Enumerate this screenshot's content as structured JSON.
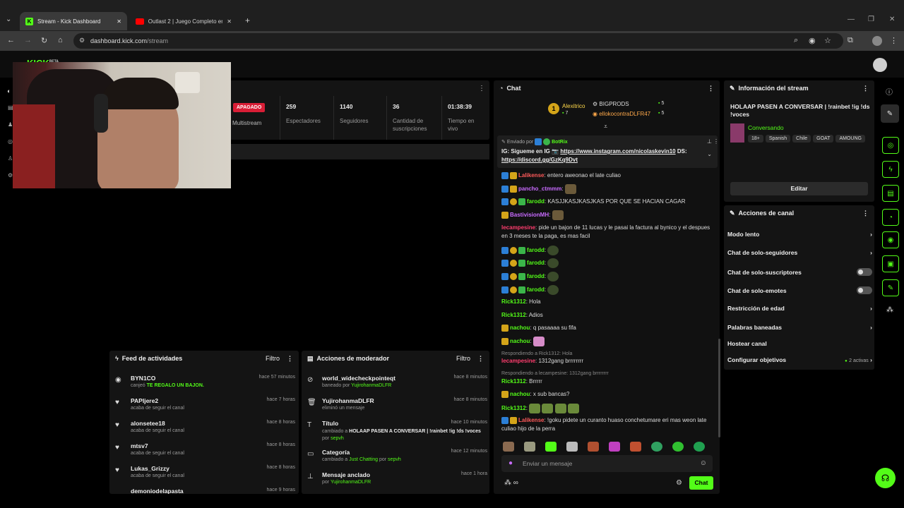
{
  "browser": {
    "tabs": [
      {
        "title": "Stream - Kick Dashboard"
      },
      {
        "title": "Outlast 2 | Juego Completo en"
      }
    ],
    "url": "dashboard.kick.com/stream",
    "url_host": "dashboard.kick.com",
    "url_path": "/stream"
  },
  "stats": {
    "status": "APAGADO",
    "multistream": "Multistream",
    "viewers_value": "259",
    "viewers_label": "Espectadores",
    "followers_value": "1140",
    "followers_label": "Seguidores",
    "subs_value": "36",
    "subs_label": "Cantidad de suscripciones",
    "live_value": "01:38:39",
    "live_label": "Tiempo en vivo"
  },
  "activity_feed": {
    "title": "Feed de actividades",
    "filter": "Filtro",
    "items": [
      {
        "user": "BYN1CO",
        "action": "canjeó",
        "extra": "TE REGALO UN BAJON.",
        "time": "hace 57 minutos"
      },
      {
        "user": "PAPIjere2",
        "action": "acaba de seguir el canal",
        "time": "hace 7 horas"
      },
      {
        "user": "alonsetee18",
        "action": "acaba de seguir el canal",
        "time": "hace 8 horas"
      },
      {
        "user": "mtsv7",
        "action": "acaba de seguir el canal",
        "time": "hace 8 horas"
      },
      {
        "user": "Lukas_Grizzy",
        "action": "acaba de seguir el canal",
        "time": "hace 8 horas"
      },
      {
        "user": "demoniodelapasta",
        "action": "",
        "time": "hace 9 horas"
      }
    ]
  },
  "mod_actions": {
    "title": "Acciones de moderador",
    "filter": "Filtro",
    "items": [
      {
        "title": "world_widecheckpointeqt",
        "sub1": "baneado por",
        "by": "YujirohanmaDLFR",
        "time": "hace 8 minutos"
      },
      {
        "title": "YujirohanmaDLFR",
        "sub1": "eliminó un mensaje",
        "by": "",
        "time": "hace 8 minutos"
      },
      {
        "title": "Título",
        "sub1": "cambiado a",
        "value": "HOLAAP PASEN A CONVERSAR | !rainbet !ig !ds !voces",
        "sub2": "por",
        "by": "sepvh",
        "time": "hace 10 minutos"
      },
      {
        "title": "Categoría",
        "sub1": "cambiado a",
        "value": "Just Chatting",
        "sub2": "por",
        "by": "sepvh",
        "time": "hace 12 minutos"
      },
      {
        "title": "Mensaje anclado",
        "sub1": "por",
        "by": "YujirohanmaDLFR",
        "time": "hace 1 hora"
      }
    ]
  },
  "chat": {
    "title": "Chat",
    "top_gifters": [
      {
        "name": "Alexitrico",
        "count": "7"
      },
      {
        "name": "BIGPRODS",
        "count": "5"
      },
      {
        "name": "ellokocontraDLFR47",
        "count": "5"
      }
    ],
    "pinned": {
      "sent_by": "Enviado por",
      "bot": "BotRix",
      "text": "IG: Sigueme en IG 📷 ",
      "link": "https://www.instagram.com/nicolaskevin10",
      "ds": " DS: ",
      "link2": "https://discord.gg/GzKq9Dvt"
    },
    "messages": [
      {
        "user": "Lalikense",
        "color": "#ff5a5a",
        "text": "entero aweonao el late culiao"
      },
      {
        "user": "pancho_ctmmm",
        "color": "#c86bff",
        "text": ""
      },
      {
        "user": "farodd",
        "color": "#53fc18",
        "text": "KASJJKASJKASJKAS POR QUE SE HACIAN CAGAR"
      },
      {
        "user": "BastivisionMH",
        "color": "#c86bff",
        "text": ""
      },
      {
        "user": "lecampesine",
        "color": "#ff3d6e",
        "text": "pide un bajon de 11 lucas y le pasai la factura al bynico y el despues en 3 meses te la paga, es mas facil"
      },
      {
        "user": "farodd",
        "color": "#53fc18",
        "text": ""
      },
      {
        "user": "farodd",
        "color": "#53fc18",
        "text": ""
      },
      {
        "user": "farodd",
        "color": "#53fc18",
        "text": ""
      },
      {
        "user": "farodd",
        "color": "#53fc18",
        "text": ""
      },
      {
        "user": "Rick1312",
        "color": "#53fc18",
        "text": "Hola"
      },
      {
        "user": "Rick1312",
        "color": "#53fc18",
        "text": "Adios"
      },
      {
        "user": "nachou",
        "color": "#53fc18",
        "text": "q pasaaaa su fifa"
      },
      {
        "user": "nachou",
        "color": "#53fc18",
        "text": ""
      },
      {
        "reply": "Respondiendo a Rick1312: Hola",
        "user": "lecampesine",
        "color": "#ff3d6e",
        "text": "1312gang brrrrrrrr"
      },
      {
        "reply": "Respondiendo a lecampesine: 1312gang brrrrrrrr",
        "user": "Rick1312",
        "color": "#53fc18",
        "text": "Brrrrr"
      },
      {
        "user": "nachou",
        "color": "#53fc18",
        "text": "x sub bancas?"
      },
      {
        "user": "Rick1312",
        "color": "#53fc18",
        "text": ""
      },
      {
        "user": "Lalikense",
        "color": "#ff5a5a",
        "text": "!goku pidete un curanto huaso conchetumare eri mas weon late culiao hijo de la perra"
      }
    ],
    "input_placeholder": "Enviar un mensaje",
    "send": "Chat"
  },
  "stream_info": {
    "title": "Información del stream",
    "stream_title": "HOLAAP PASEN A CONVERSAR | !rainbet !ig !ds !voces",
    "category": "Conversando",
    "tags": [
      "18+",
      "Spanish",
      "Chile",
      "GOAT",
      "AMOUNG"
    ],
    "edit": "Editar"
  },
  "channel_actions": {
    "title": "Acciones de canal",
    "items": [
      {
        "label": "Modo lento"
      },
      {
        "label": "Chat de solo-seguidores"
      },
      {
        "label": "Chat de solo-suscriptores"
      },
      {
        "label": "Chat de solo-emotes"
      },
      {
        "label": "Restricción de edad"
      },
      {
        "label": "Palabras baneadas"
      },
      {
        "label": "Hostear canal"
      },
      {
        "label": "Configurar objetivos",
        "status": "2 activas"
      }
    ]
  },
  "logo": {
    "text": "KICK",
    "beta": "BETA"
  },
  "colors": {
    "accent": "#53fc18",
    "panel": "#141414",
    "bg": "#000000"
  }
}
